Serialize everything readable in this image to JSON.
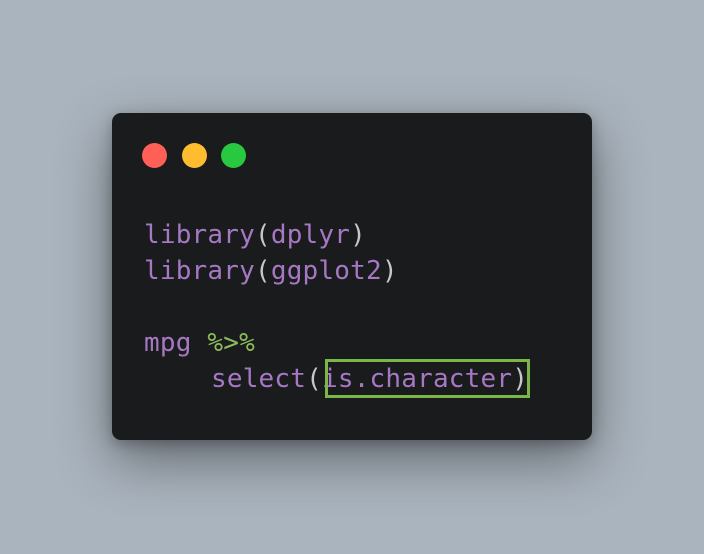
{
  "code": {
    "line1": {
      "fn": "library",
      "open": "(",
      "arg": "dplyr",
      "close": ")"
    },
    "line2": {
      "fn": "library",
      "open": "(",
      "arg": "ggplot2",
      "close": ")"
    },
    "line3": {
      "obj": "mpg",
      "space": " ",
      "pipe": "%>%"
    },
    "line4": {
      "fn": "select",
      "open": "(",
      "arg": "is.character",
      "close": ")"
    }
  },
  "colors": {
    "background": "#aab4be",
    "window": "#1a1b1d",
    "keyword": "#a678c4",
    "operator": "#8cbc5c",
    "highlight_border": "#7ab648",
    "close_button": "#fe5f57",
    "minimize_button": "#febc2e",
    "maximize_button": "#28c840"
  }
}
